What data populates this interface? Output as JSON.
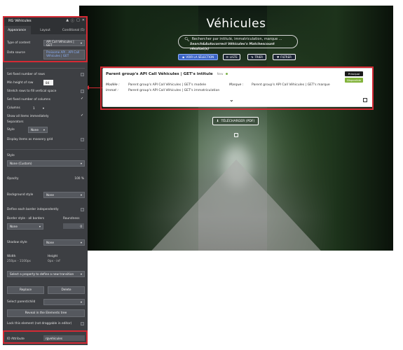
{
  "canvas": {
    "title": "Véhicules",
    "search": {
      "placeholder": "Rechercher par intitulé, immatriculation, marque ...",
      "results_line": "Search&Autocorrect Véhicules's Matchescount résultat(s)"
    },
    "toolbar": {
      "view_selection": "VOIR LA SÉLECTION",
      "list": "LISTE",
      "sort": "TRIER",
      "filter": "FILTRER"
    },
    "card": {
      "title": "Parent group's API Call Véhicules | GET's intitule",
      "new_label": "New",
      "badge_principal": "Principal",
      "badge_available": "Disponible",
      "model_label": "Modèle :",
      "model_value": "Parent group's API Call Véhicules | GET's modele",
      "brand_label": "Marque :",
      "brand_value": "Parent group's API Call Véhicules | GET's marque",
      "plate_label": "Immat :",
      "plate_value": "Parent group's API Call Véhicules | GET's immatriculation"
    },
    "download_label": "TÉLÉCHARGER (PDF)"
  },
  "editor": {
    "title": "RG Véhicules",
    "tabs": [
      "Appearance",
      "Layout",
      "Conditional (5)"
    ],
    "type_of_content_label": "Type of content",
    "type_of_content_value": "API Call Véhicules | GET",
    "data_source_label": "Data source",
    "data_source_value": "Preisome API - API Call Véhicules | GET",
    "set_fixed_rows": "Set fixed number of rows",
    "min_height_label": "Min height of row",
    "min_height_value": "84",
    "stretch_rows": "Stretch rows to fill vertical space",
    "set_fixed_columns": "Set fixed number of columns",
    "columns_label": "Columns",
    "columns_value": "1",
    "show_all_items": "Show all items immediately",
    "separators_label": "Separators",
    "style_label": "Style",
    "separator_style_value": "None",
    "masonry": "Display items as masonry grid",
    "style_section_label": "Style",
    "style_value": "None (Custom)",
    "opacity_label": "Opacity",
    "opacity_value": "100 %",
    "background_style_label": "Background style",
    "background_style_value": "None",
    "define_borders": "Define each border independently",
    "border_style_label": "Border style - all borders",
    "roundness_label": "Roundness",
    "border_style_value": "None",
    "roundness_value": "0",
    "shadow_style_label": "Shadow style",
    "shadow_style_value": "None",
    "width_label": "Width",
    "width_value": "250px - 1100px",
    "height_label": "Height",
    "height_value": "0px - inf",
    "transition_placeholder": "Select a property to define a new transition",
    "replace_button": "Replace",
    "delete_button": "Delete",
    "select_parent_label": "Select parent/child",
    "reveal_button": "Reveal in the Elements tree",
    "lock_label": "Lock this element (not draggable in editor)",
    "id_attribute_label": "ID Attribute",
    "id_attribute_value": "rgvehicules"
  }
}
